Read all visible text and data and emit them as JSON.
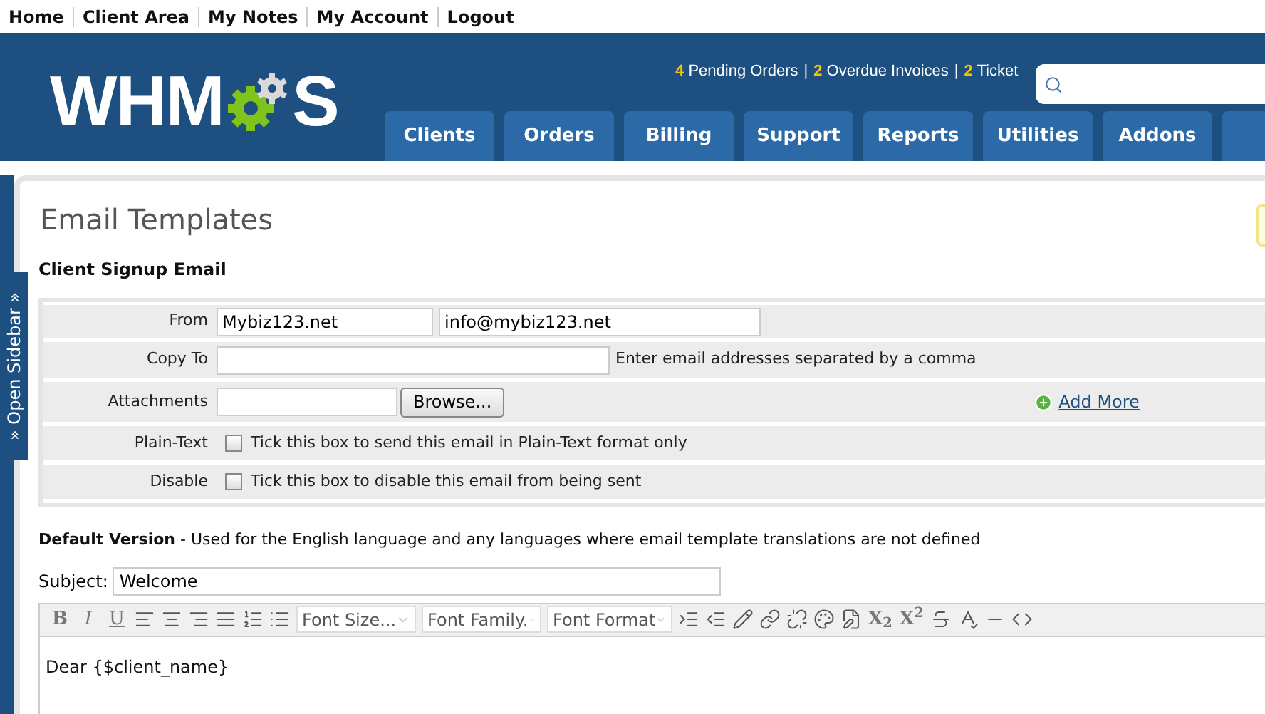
{
  "top_links": [
    "Home",
    "Client Area",
    "My Notes",
    "My Account",
    "Logout"
  ],
  "logo": {
    "before": "WHM",
    "after": "S"
  },
  "stats": [
    {
      "count": "4",
      "label": "Pending Orders"
    },
    {
      "count": "2",
      "label": "Overdue Invoices"
    },
    {
      "count": "2",
      "label": "Ticket"
    }
  ],
  "stats_separator": "|",
  "nav_tabs": [
    "Clients",
    "Orders",
    "Billing",
    "Support",
    "Reports",
    "Utilities",
    "Addons"
  ],
  "sidebar_toggle": "» Open Sidebar »",
  "page_title": "Email Templates",
  "section_title": "Client Signup Email",
  "form": {
    "from_label": "From",
    "from_name": "Mybiz123.net",
    "from_email": "info@mybiz123.net",
    "copy_label": "Copy To",
    "copy_hint": "Enter email addresses separated by a comma",
    "attach_label": "Attachments",
    "browse": "Browse...",
    "add_more": "Add More",
    "options": [
      {
        "label": "Plain-Text",
        "text": "Tick this box to send this email in Plain-Text format only",
        "checked": false
      },
      {
        "label": "Disable",
        "text": "Tick this box to disable this email from being sent",
        "checked": false
      }
    ]
  },
  "default_version": "**Default Version** - Used for the English language and any languages where email template translations are not defined",
  "subject_label": "Subject:",
  "subject": "Welcome",
  "toolbar": {
    "format": [
      "B",
      "I",
      "U"
    ],
    "selects": [
      "Font Size...",
      "Font Family.",
      "Font Format"
    ],
    "scripts": [
      "X$_{2}$",
      "X$^{2}$"
    ]
  },
  "body_text": "Dear {$client_name}"
}
